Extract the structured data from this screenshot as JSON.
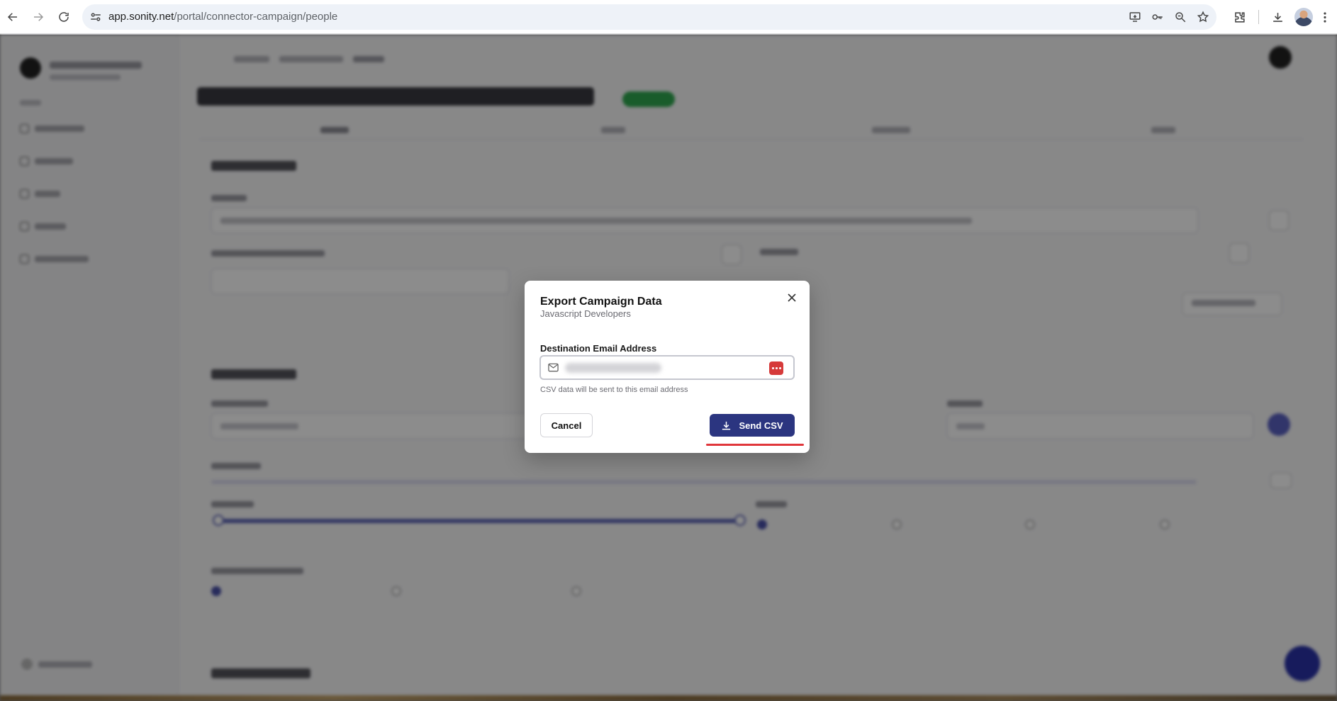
{
  "browser": {
    "url_host": "app.sonity.net",
    "url_path": "/portal/connector-campaign/people"
  },
  "modal": {
    "title": "Export Campaign Data",
    "subtitle": "Javascript Developers",
    "email_label": "Destination Email Address",
    "email_value": "",
    "email_help": "CSV data will be sent to this email address",
    "cancel_label": "Cancel",
    "send_label": "Send CSV"
  },
  "colors": {
    "primary_button": "#2b3580",
    "highlight_underline": "#e0363b",
    "password_manager_icon": "#d63a3a"
  }
}
